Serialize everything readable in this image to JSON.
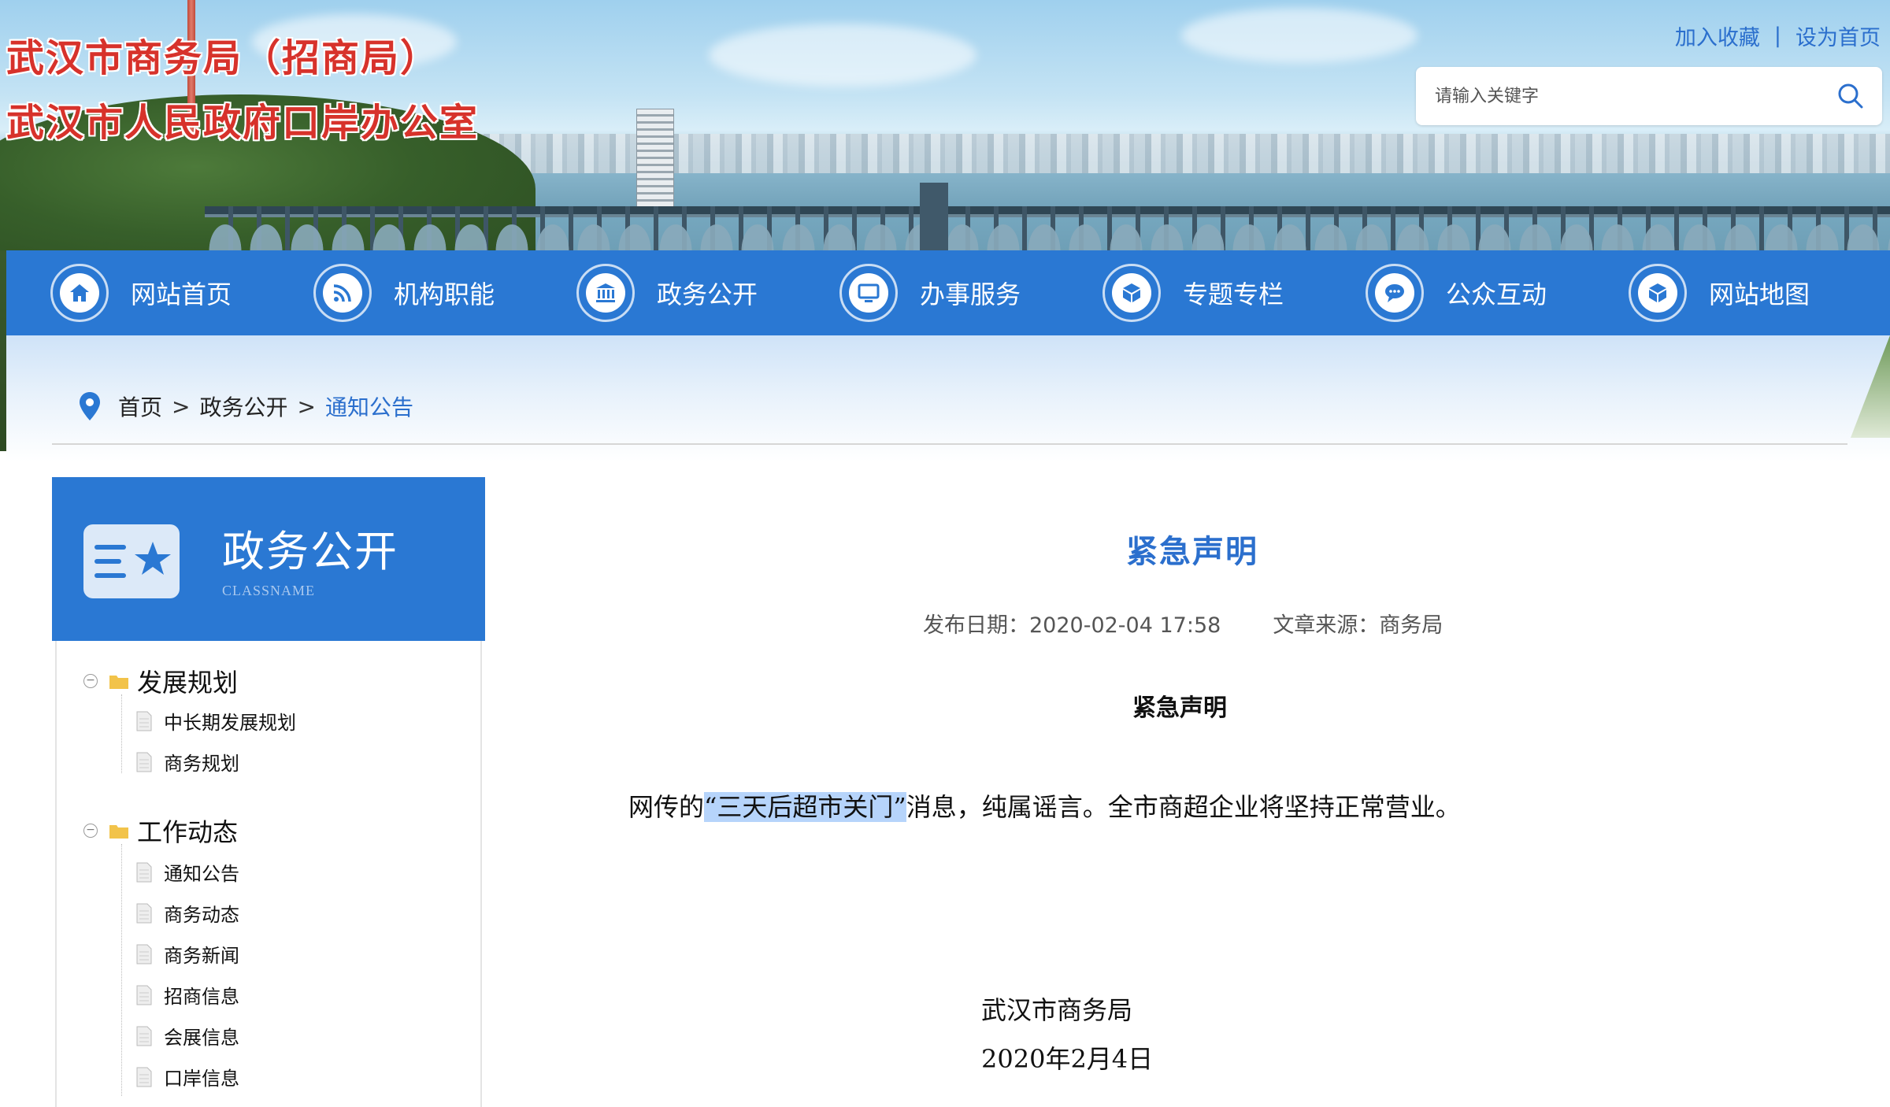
{
  "header": {
    "title_line1": "武汉市商务局（招商局）",
    "title_line2": "武汉市人民政府口岸办公室",
    "links": {
      "favorite": "加入收藏",
      "separator": "|",
      "homepage": "设为首页"
    },
    "search": {
      "placeholder": "请输入关键字"
    }
  },
  "nav": {
    "items": [
      {
        "label": "网站首页",
        "icon": "home-icon"
      },
      {
        "label": "机构职能",
        "icon": "rss-icon"
      },
      {
        "label": "政务公开",
        "icon": "bank-icon"
      },
      {
        "label": "办事服务",
        "icon": "monitor-icon"
      },
      {
        "label": "专题专栏",
        "icon": "cube-icon"
      },
      {
        "label": "公众互动",
        "icon": "chat-icon"
      },
      {
        "label": "网站地图",
        "icon": "box-icon"
      }
    ]
  },
  "breadcrumb": {
    "home": "首页",
    "sep": ">",
    "section": "政务公开",
    "current": "通知公告"
  },
  "sidebar": {
    "title": "政务公开",
    "subtitle": "CLASSNAME",
    "groups": [
      {
        "label": "发展规划",
        "items": [
          "中长期发展规划",
          "商务规划"
        ]
      },
      {
        "label": "工作动态",
        "items": [
          "通知公告",
          "商务动态",
          "商务新闻",
          "招商信息",
          "会展信息",
          "口岸信息"
        ]
      }
    ]
  },
  "article": {
    "title": "紧急声明",
    "date_label": "发布日期：2020-02-04 17:58",
    "source_label": "文章来源：商务局",
    "heading": "紧急声明",
    "body_before": "网传的",
    "body_highlight": "“三天后超市关门”",
    "body_after": "消息，纯属谣言。全市商超企业将坚持正常营业。",
    "signature": "武汉市商务局",
    "sign_date": "2020年2月4日"
  },
  "colors": {
    "brand_blue": "#2a78d3",
    "title_red": "#d7322b",
    "link_blue": "#2b6fcd",
    "highlight": "#b6d4fb"
  }
}
